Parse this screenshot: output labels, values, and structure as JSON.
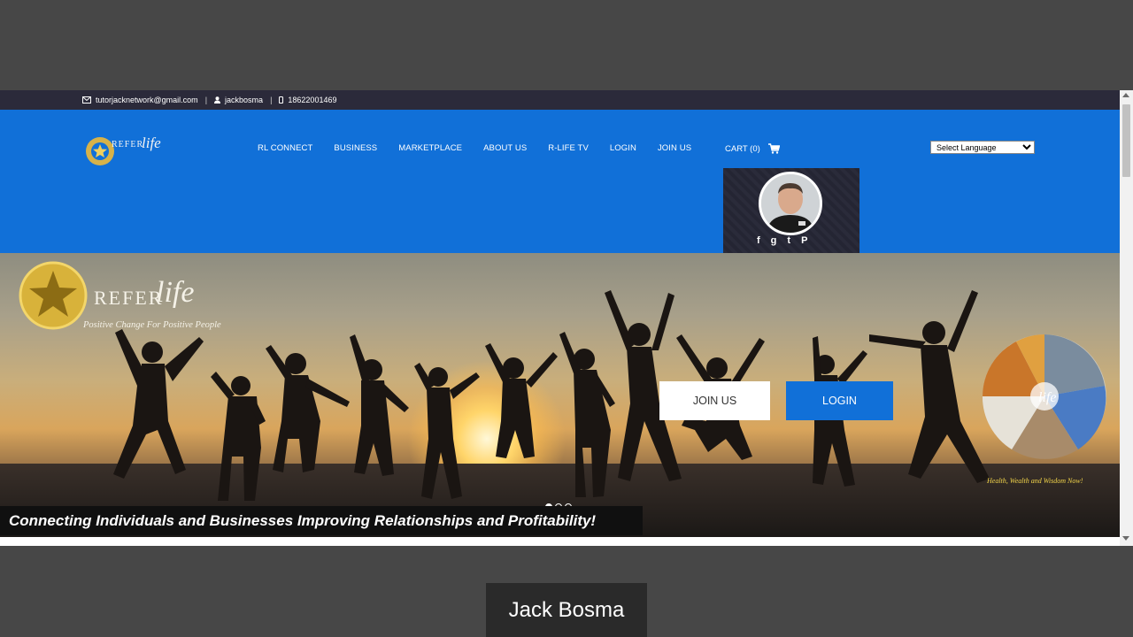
{
  "topbar": {
    "email": "tutorjacknetwork@gmail.com",
    "username": "jackbosma",
    "phone": "18622001469",
    "separator": "|",
    "icons": [
      "envelope-icon",
      "user-icon",
      "phone-icon"
    ]
  },
  "header": {
    "logo_refer": "REFER",
    "logo_life": "life",
    "nav": [
      {
        "label": "RL CONNECT"
      },
      {
        "label": "BUSINESS"
      },
      {
        "label": "MARKETPLACE"
      },
      {
        "label": "ABOUT US"
      },
      {
        "label": "R-LIFE TV"
      },
      {
        "label": "LOGIN"
      },
      {
        "label": "JOIN US"
      }
    ],
    "cart_label": "CART (0)",
    "cart_icon": "cart-icon",
    "language_select": "Select Language",
    "social": [
      "f",
      "g",
      "t",
      "P"
    ]
  },
  "hero": {
    "logo_refer": "REFER",
    "logo_life": "life",
    "logo_tagline": "Positive Change For Positive People",
    "join_label": "JOIN US",
    "login_label": "LOGIN",
    "collage_life": "life",
    "collage_tagline": "Health, Wealth and Wisdom Now!",
    "banner": "Connecting Individuals and Businesses Improving Relationships and Profitability!",
    "slide_count": 3,
    "active_slide": 1
  },
  "caption": {
    "name": "Jack Bosma"
  },
  "colors": {
    "header_blue": "#1170d8",
    "topbar": "#2b2a3a",
    "outer_background": "#474747"
  }
}
